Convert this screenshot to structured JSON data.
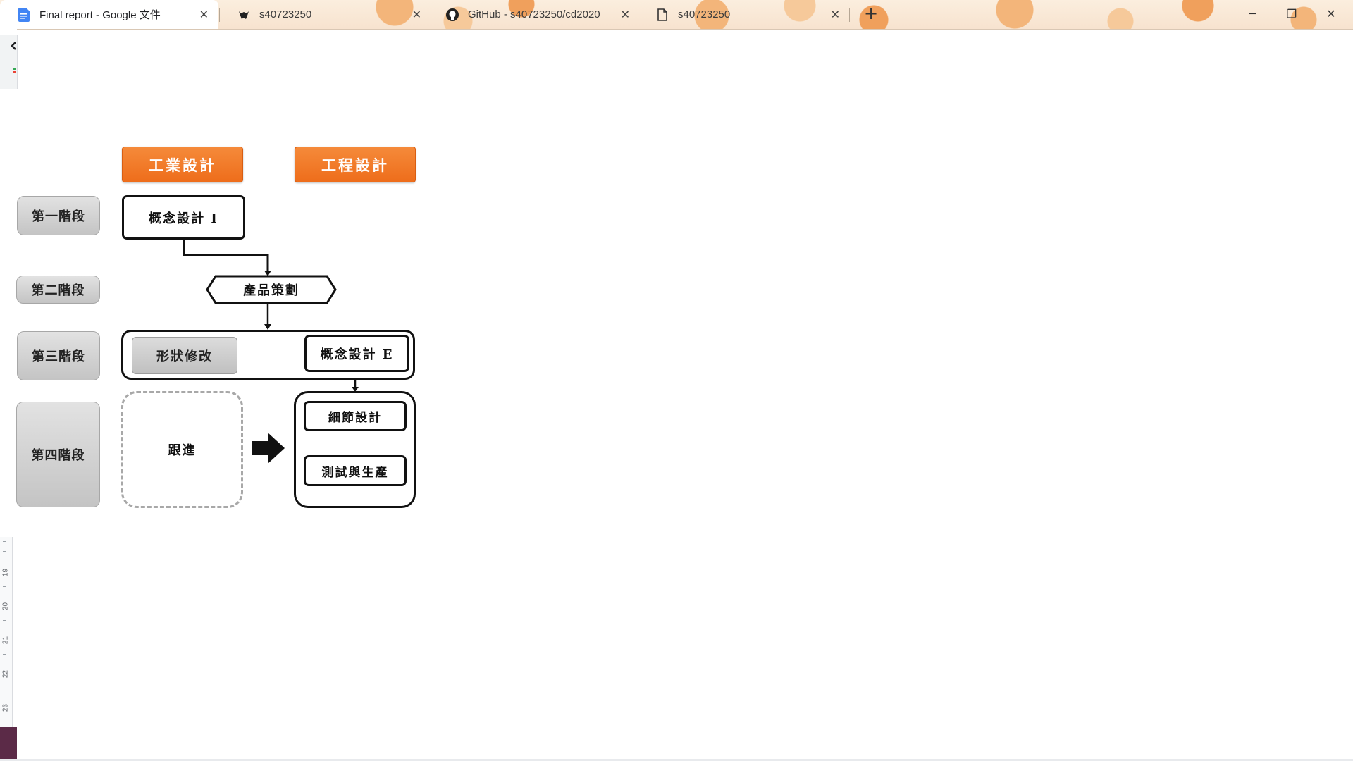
{
  "browser": {
    "tabs": [
      {
        "title": "Final report - Google 文件",
        "icon": "google-docs-icon",
        "active": true
      },
      {
        "title": "s40723250",
        "icon": "cattle-icon",
        "active": false
      },
      {
        "title": "GitHub - s40723250/cd2020",
        "icon": "github-icon",
        "active": false
      },
      {
        "title": "s40723250",
        "icon": "page-icon",
        "active": false
      }
    ],
    "new_tab_symbol": "+",
    "window_controls": {
      "minimize": "─",
      "maximize": "❐",
      "close": "✕"
    },
    "tab_close_symbol": "✕"
  },
  "ruler": {
    "numbers": [
      "19",
      "20",
      "21",
      "22",
      "23"
    ]
  },
  "diagram": {
    "headers": {
      "industrial": "工業設計",
      "engineering": "工程設計"
    },
    "stages": [
      "第一階段",
      "第二階段",
      "第三階段",
      "第四階段"
    ],
    "nodes": {
      "concept_i": "概念設計 I",
      "product_planning": "產品策劃",
      "shape_modify": "形狀修改",
      "concept_e": "概念設計 E",
      "follow_up": "跟進",
      "detail_design": "細節設計",
      "test_production": "測試與生產"
    }
  },
  "colors": {
    "header_orange": "#ee6d1b",
    "stage_gray": "#c4c4c4",
    "tab_theme": "#f3b57a"
  }
}
